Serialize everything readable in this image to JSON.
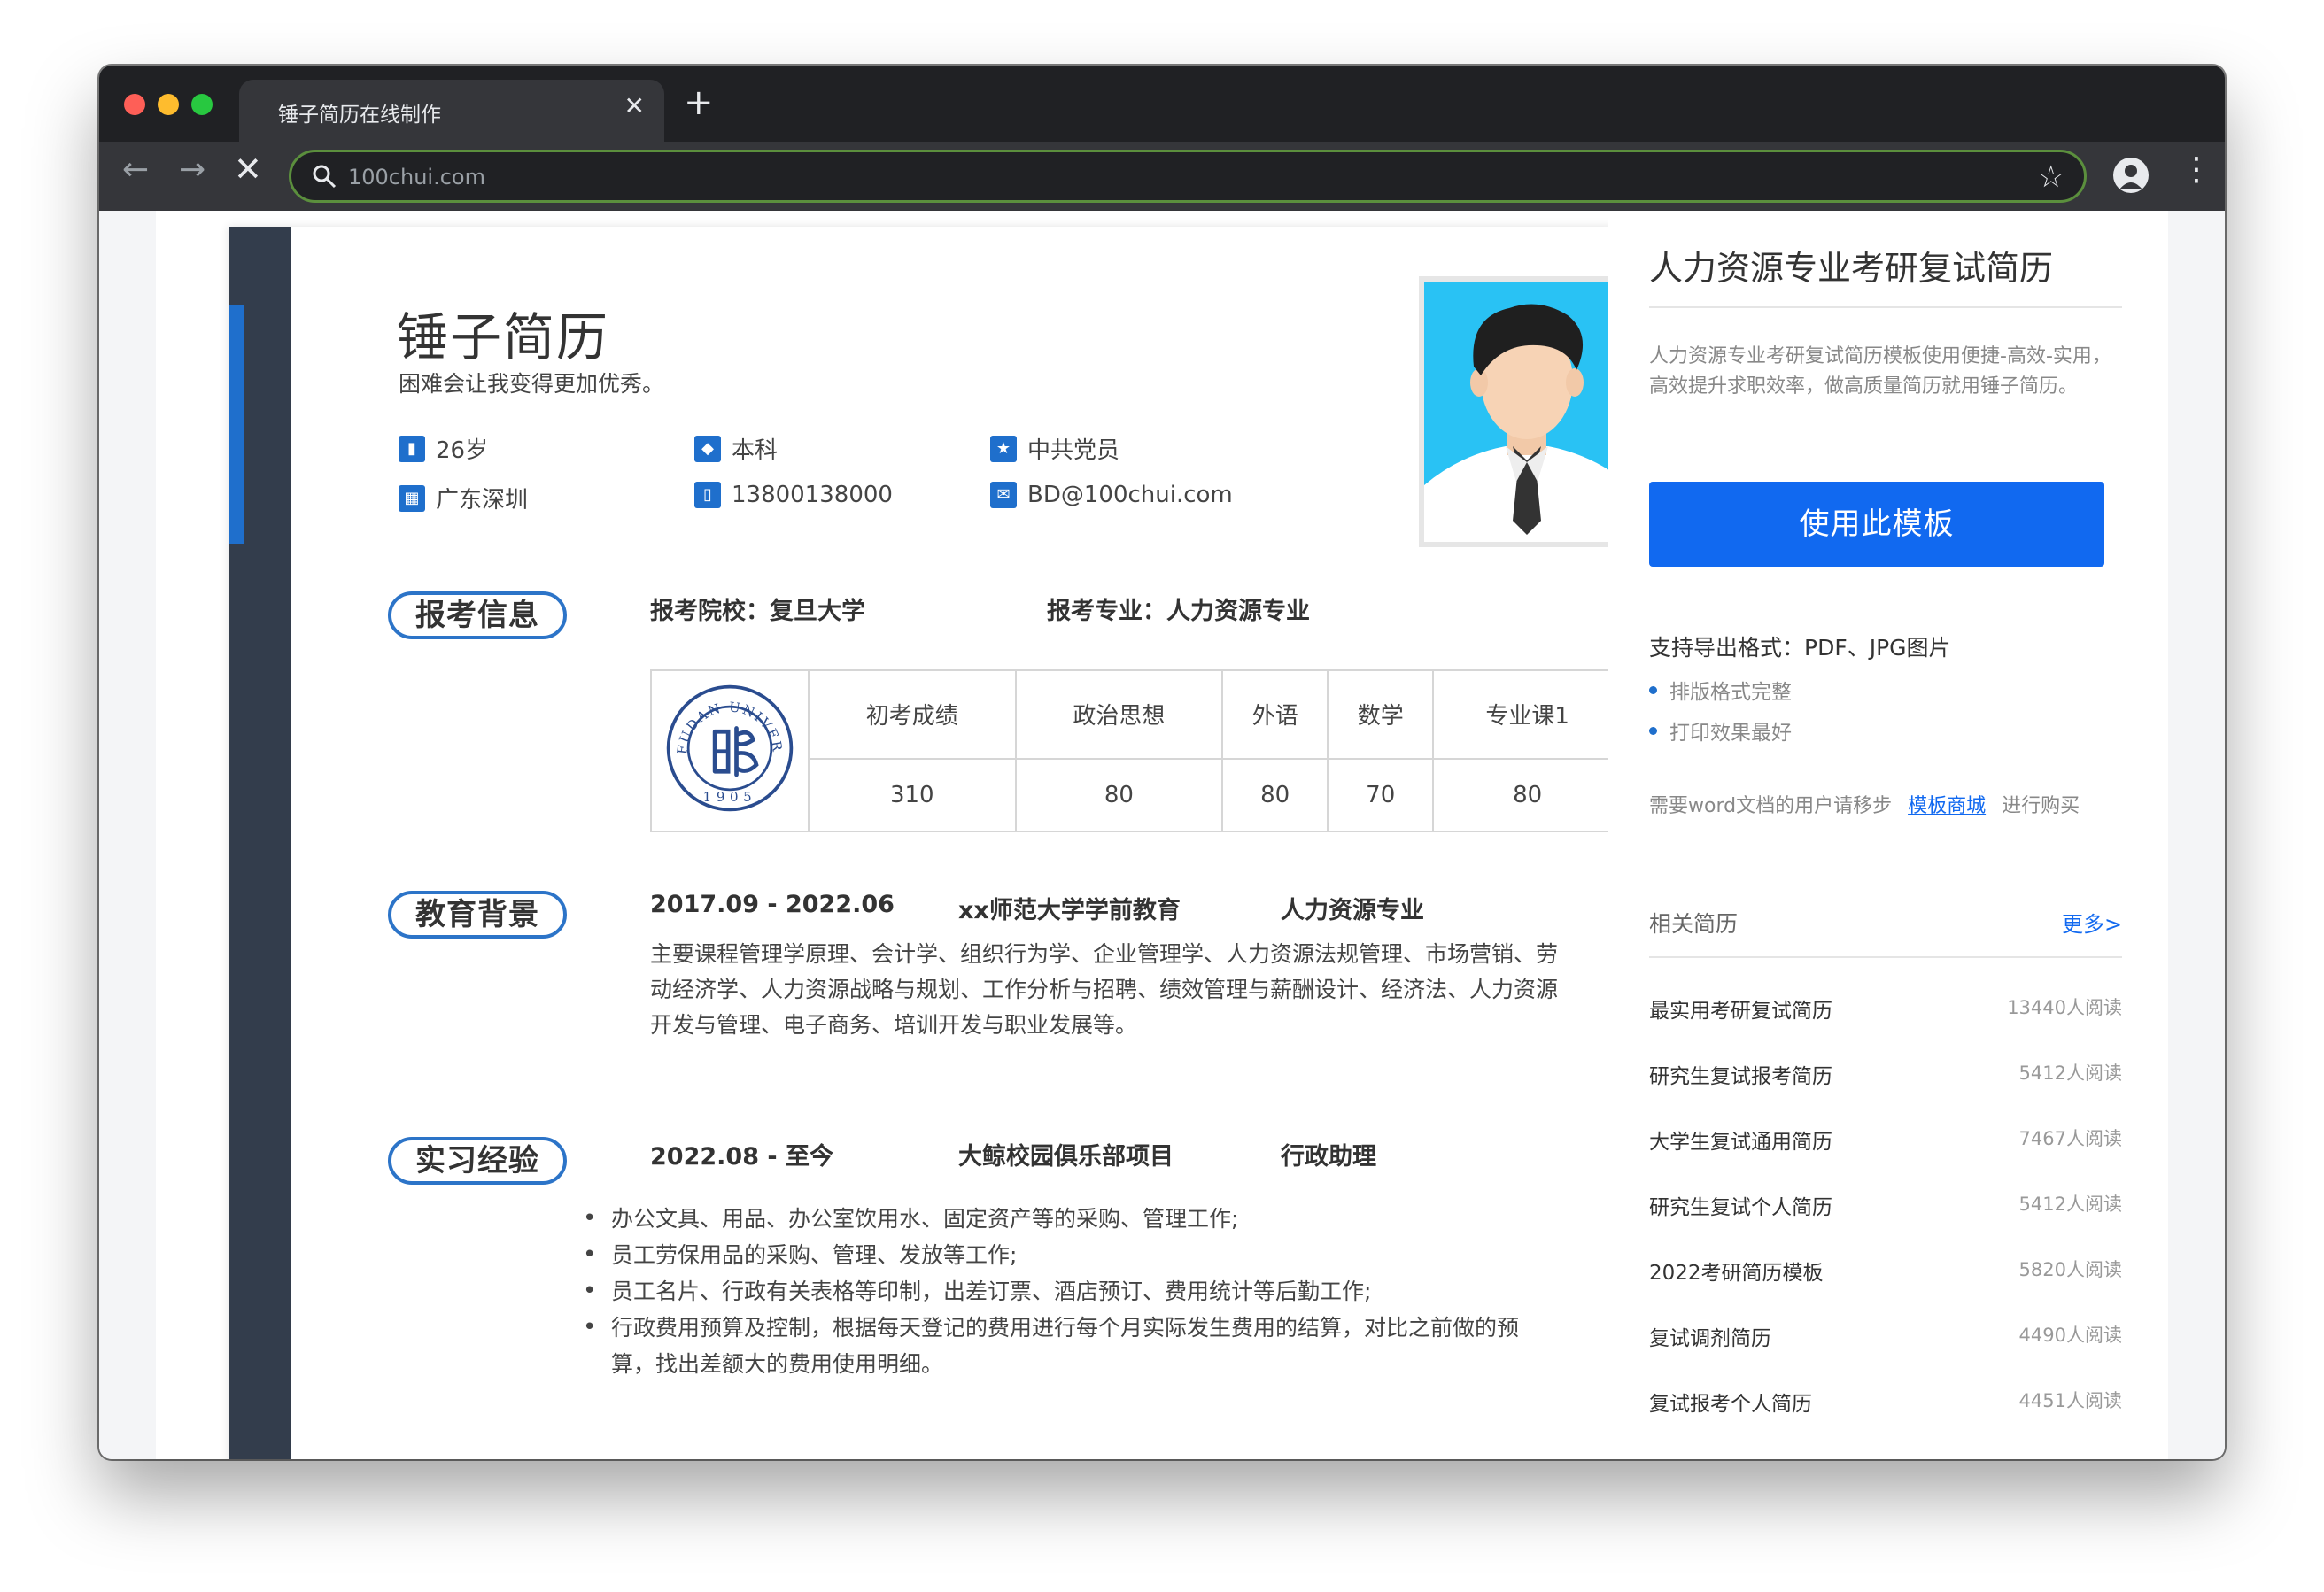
{
  "browser": {
    "tab_title": "锤子简历在线制作",
    "tab_close": "✕",
    "new_tab": "+",
    "url": "100chui.com"
  },
  "resume": {
    "name": "锤子简历",
    "motto": "困难会让我变得更加优秀。",
    "info": {
      "age": "26岁",
      "degree": "本科",
      "politics": "中共党员",
      "location": "广东深圳",
      "phone": "13800138000",
      "email": "BD@100chui.com"
    },
    "exam": {
      "section": "报考信息",
      "school": "报考院校：复旦大学",
      "major": "报考专业：人力资源专业",
      "headers": [
        "初考成绩",
        "政治思想",
        "外语",
        "数学",
        "专业课1"
      ],
      "scores": [
        "310",
        "80",
        "80",
        "70",
        "80"
      ],
      "logo_text": "FUDAN UNIVERSITY",
      "logo_year": "1905"
    },
    "education": {
      "section": "教育背景",
      "period": "2017.09 - 2022.06",
      "school": "xx师范大学学前教育",
      "major": "人力资源专业",
      "lines": [
        "主要课程管理学原理、会计学、组织行为学、企业管理学、人力资源法规管理、市场营销、劳",
        "动经济学、人力资源战略与规划、工作分析与招聘、绩效管理与薪酬设计、经济法、人力资源",
        "开发与管理、电子商务、培训开发与职业发展等。"
      ]
    },
    "internship": {
      "section": "实习经验",
      "period": "2022.08 - 至今",
      "org": "大鲸校园俱乐部项目",
      "role": "行政助理",
      "bullets": [
        "办公文具、用品、办公室饮用水、固定资产等的采购、管理工作;",
        "员工劳保用品的采购、管理、发放等工作;",
        "员工名片、行政有关表格等印制，出差订票、酒店预订、费用统计等后勤工作;",
        "行政费用预算及控制，根据每天登记的费用进行每个月实际发生费用的结算，对比之前做的预算，找出差额大的费用使用明细。"
      ]
    }
  },
  "sidebar": {
    "title": "人力资源专业考研复试简历",
    "description": "人力资源专业考研复试简历模板使用便捷-高效-实用，高效提升求职效率，做高质量简历就用锤子简历。",
    "use_button": "使用此模板",
    "export_formats": "支持导出格式：PDF、JPG图片",
    "features": [
      "排版格式完整",
      "打印效果最好"
    ],
    "word_prefix": "需要word文档的用户请移步",
    "word_link": "模板商城",
    "word_suffix": "进行购买",
    "related_label": "相关简历",
    "more_label": "更多>",
    "related": [
      {
        "name": "最实用考研复试简历",
        "reads": "13440人阅读"
      },
      {
        "name": "研究生复试报考简历",
        "reads": "5412人阅读"
      },
      {
        "name": "大学生复试通用简历",
        "reads": "7467人阅读"
      },
      {
        "name": "研究生复试个人简历",
        "reads": "5412人阅读"
      },
      {
        "name": "2022考研简历模板",
        "reads": "5820人阅读"
      },
      {
        "name": "复试调剂简历",
        "reads": "4490人阅读"
      },
      {
        "name": "复试报考个人简历",
        "reads": "4451人阅读"
      }
    ]
  },
  "colors": {
    "accent": "#1f6fcc",
    "button": "#1169f0",
    "rail": "#333d4c",
    "photo_bg": "#29c2f4"
  }
}
